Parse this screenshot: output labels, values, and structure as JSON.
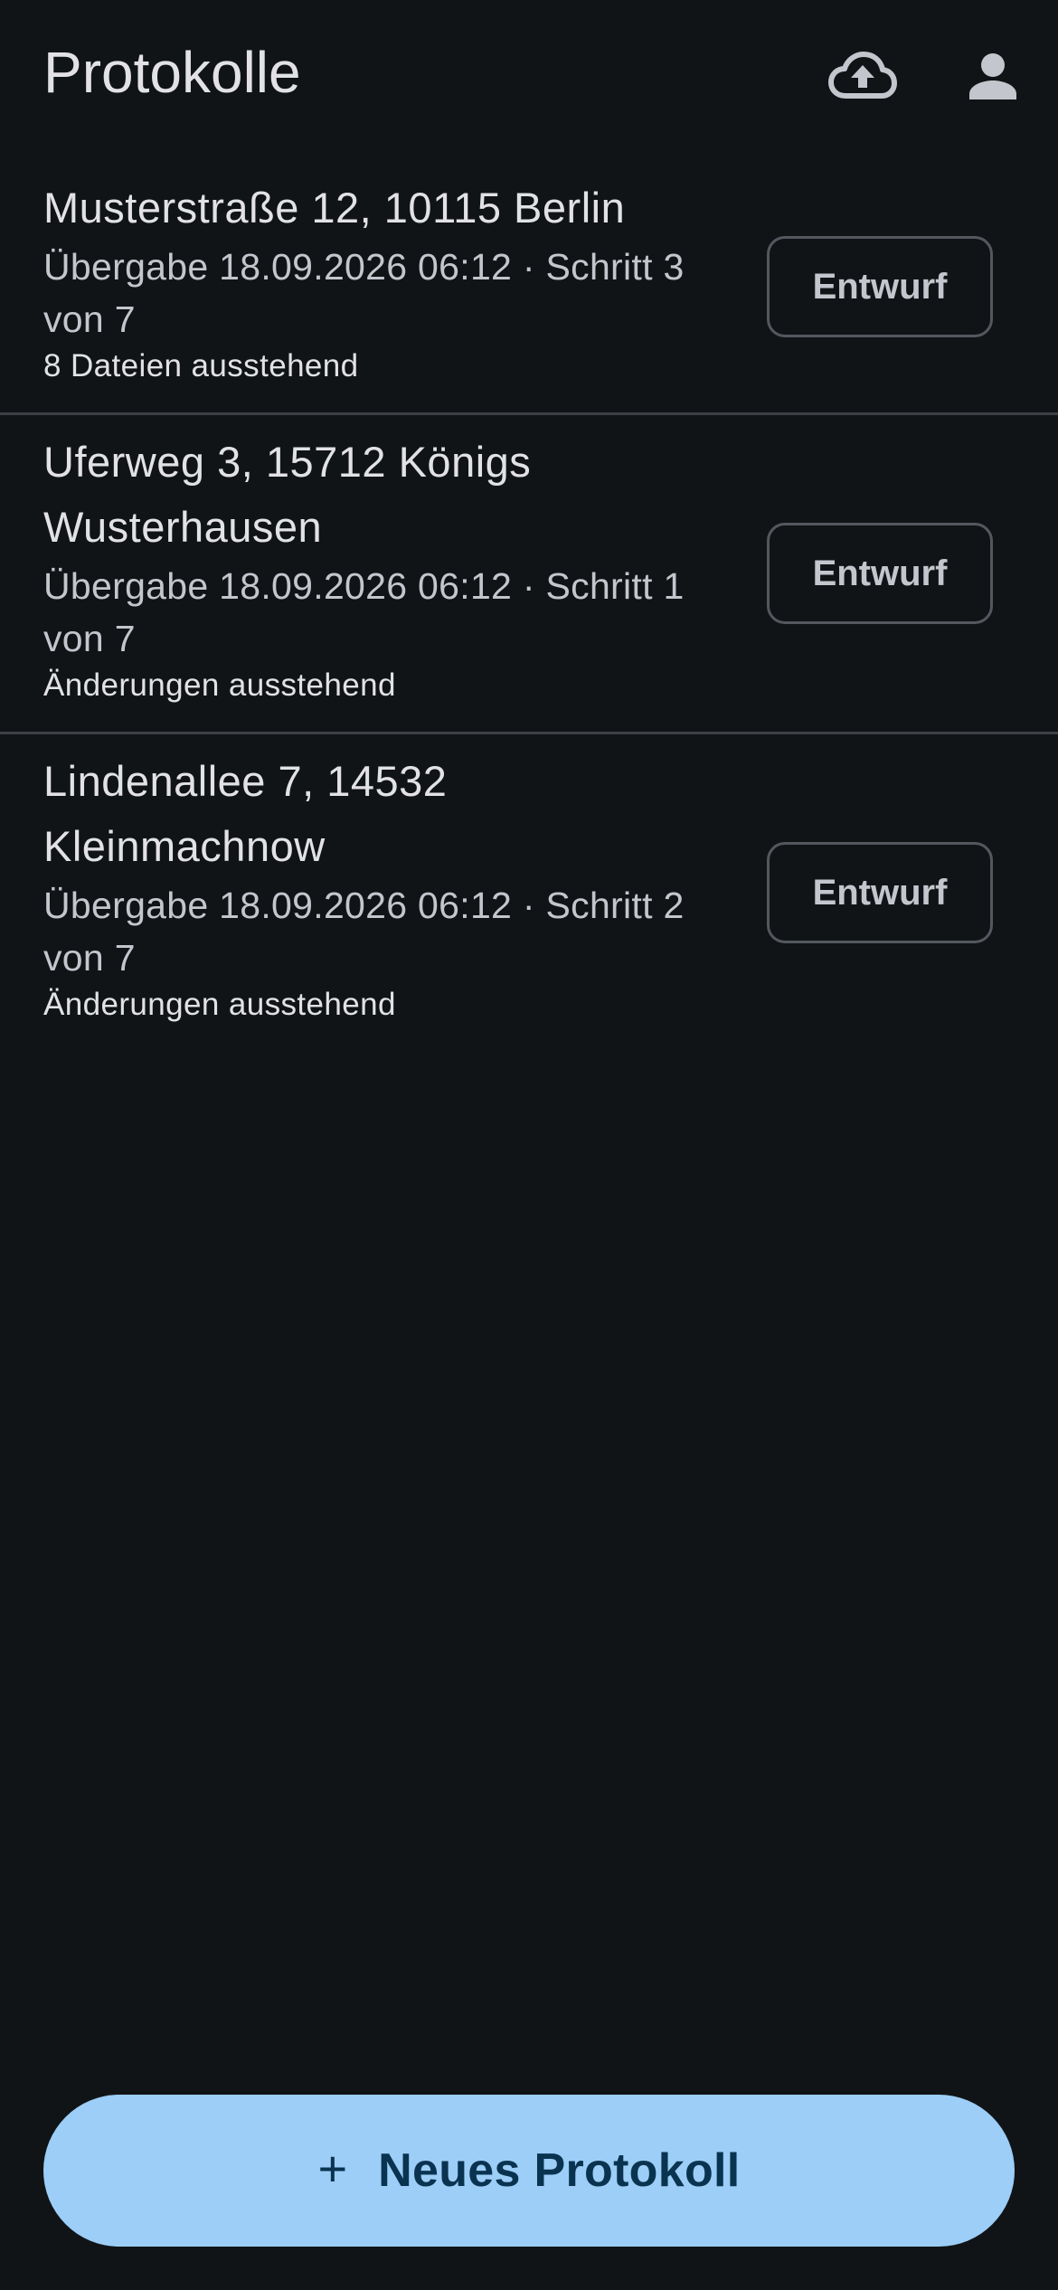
{
  "header": {
    "title": "Protokolle",
    "upload_icon": "cloud-upload-icon",
    "account_icon": "account-icon"
  },
  "protocols": [
    {
      "address": "Musterstraße 12, 10115 Berlin",
      "details": "Übergabe 18.09.2026 06:12 · Schritt 3 von 7",
      "status": "8 Dateien ausstehend",
      "badge": "Entwurf"
    },
    {
      "address": "Uferweg 3, 15712 Königs Wusterhausen",
      "details": "Übergabe 18.09.2026 06:12 · Schritt 1 von 7",
      "status": "Änderungen ausstehend",
      "badge": "Entwurf"
    },
    {
      "address": "Lindenallee 7, 14532 Kleinmachnow",
      "details": "Übergabe 18.09.2026 06:12 · Schritt 2 von 7",
      "status": "Änderungen ausstehend",
      "badge": "Entwurf"
    }
  ],
  "fab": {
    "icon": "plus-icon",
    "plus_glyph": "+",
    "label": "Neues Protokoll"
  },
  "colors": {
    "background": "#111417",
    "fab_background": "#9ccef7",
    "fab_text": "#0a3350",
    "divider": "#3d4146"
  }
}
